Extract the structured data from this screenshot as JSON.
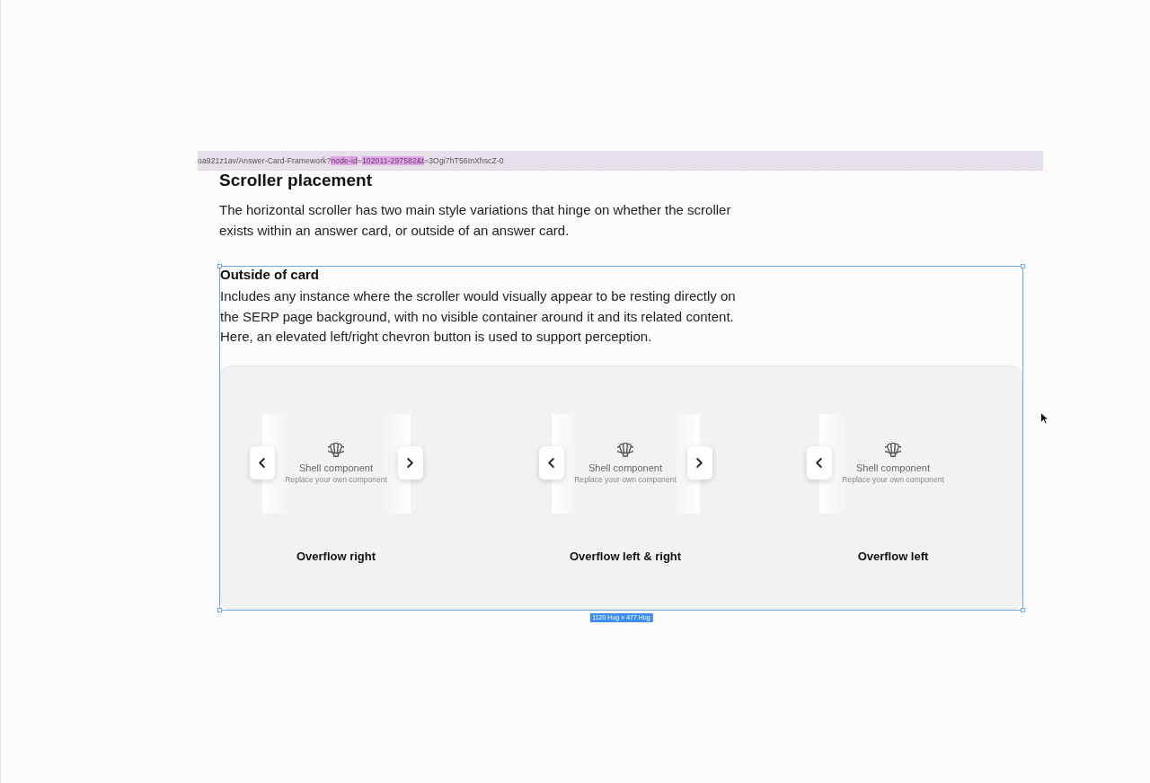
{
  "url_bar": {
    "segments": [
      {
        "text": "oa921z1av/Answer-Card-Framework?",
        "highlighted": false
      },
      {
        "text": "node-id",
        "highlighted": true
      },
      {
        "text": "=",
        "highlighted": false
      },
      {
        "text": "102011-297582&t",
        "highlighted": true
      },
      {
        "text": "=3Ogi7hT56InXhscZ-0",
        "highlighted": false
      }
    ]
  },
  "heading": "Scroller placement",
  "intro": "The horizontal scroller has two main style variations that hinge on whether the scroller exists within an answer card, or outside of an answer card.",
  "selection": {
    "size_label": "1120 Hug × 477 Hug"
  },
  "section": {
    "title": "Outside of card",
    "body": "Includes any instance where the scroller would visually appear to be resting directly on the SERP page background, with no visible container around it and its related content. Here, an elevated left/right chevron button is used to support perception."
  },
  "examples": [
    {
      "label": "Overflow right",
      "title": "Shell component",
      "subtitle": "Replace your own component",
      "left_button": true,
      "right_button": true,
      "left_fade": true,
      "right_fade": true
    },
    {
      "label": "Overflow left & right",
      "title": "Shell component",
      "subtitle": "Replace your own component",
      "left_button": true,
      "right_button": true,
      "left_fade": true,
      "right_fade": true
    },
    {
      "label": "Overflow left",
      "title": "Shell component",
      "subtitle": "Replace your own component",
      "left_button": true,
      "right_button": false,
      "left_fade": true,
      "right_fade": false
    }
  ]
}
